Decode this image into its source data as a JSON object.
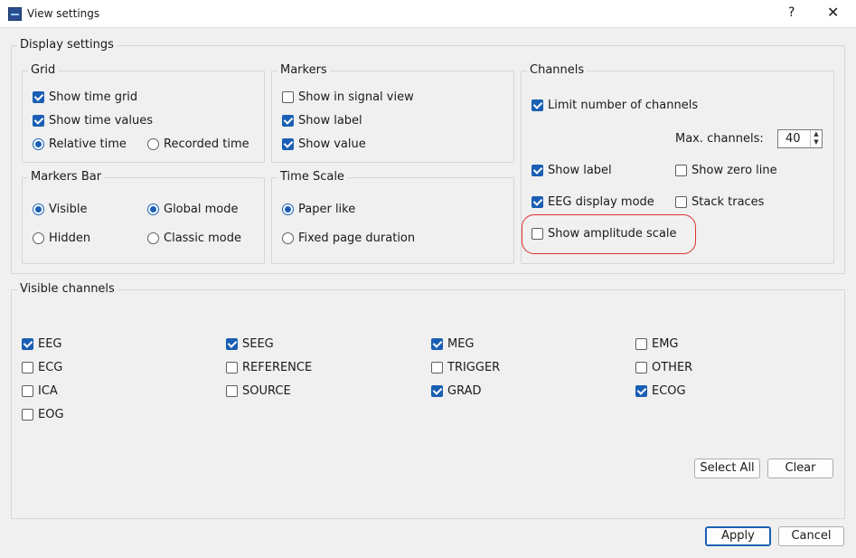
{
  "window": {
    "title": "View settings",
    "help": "?",
    "close": "✕"
  },
  "display": {
    "legend": "Display settings",
    "grid": {
      "legend": "Grid",
      "show_time_grid": {
        "label": "Show time grid",
        "checked": true
      },
      "show_time_values": {
        "label": "Show time values",
        "checked": true
      },
      "relative_time": {
        "label": "Relative time",
        "selected": true
      },
      "recorded_time": {
        "label": "Recorded time",
        "selected": false
      }
    },
    "markers": {
      "legend": "Markers",
      "show_in_signal_view": {
        "label": "Show in signal view",
        "checked": false
      },
      "show_label": {
        "label": "Show label",
        "checked": true
      },
      "show_value": {
        "label": "Show value",
        "checked": true
      }
    },
    "markers_bar": {
      "legend": "Markers Bar",
      "visible": {
        "label": "Visible",
        "selected": true
      },
      "hidden": {
        "label": "Hidden",
        "selected": false
      },
      "global_mode": {
        "label": "Global mode",
        "selected": true
      },
      "classic_mode": {
        "label": "Classic mode",
        "selected": false
      }
    },
    "time_scale": {
      "legend": "Time Scale",
      "paper_like": {
        "label": "Paper like",
        "selected": true
      },
      "fixed_page_duration": {
        "label": "Fixed page duration",
        "selected": false
      }
    },
    "channels": {
      "legend": "Channels",
      "limit_number": {
        "label": "Limit number of channels",
        "checked": true
      },
      "max_channels_label": "Max. channels:",
      "max_channels_value": "40",
      "spin_up": "▲",
      "spin_down": "▼",
      "show_label": {
        "label": "Show label",
        "checked": true
      },
      "show_zero_line": {
        "label": "Show zero line",
        "checked": false
      },
      "eeg_display_mode": {
        "label": "EEG display mode",
        "checked": true
      },
      "stack_traces": {
        "label": "Stack traces",
        "checked": false
      },
      "show_amplitude_scale": {
        "label": "Show amplitude scale",
        "checked": false
      }
    }
  },
  "visible_channels": {
    "legend": "Visible channels",
    "items": [
      {
        "label": "EEG",
        "checked": true
      },
      {
        "label": "SEEG",
        "checked": true
      },
      {
        "label": "MEG",
        "checked": true
      },
      {
        "label": "EMG",
        "checked": false
      },
      {
        "label": "ECG",
        "checked": false
      },
      {
        "label": "REFERENCE",
        "checked": false
      },
      {
        "label": "TRIGGER",
        "checked": false
      },
      {
        "label": "OTHER",
        "checked": false
      },
      {
        "label": "ICA",
        "checked": false
      },
      {
        "label": "SOURCE",
        "checked": false
      },
      {
        "label": "GRAD",
        "checked": true
      },
      {
        "label": "ECOG",
        "checked": true
      },
      {
        "label": "EOG",
        "checked": false
      }
    ],
    "select_all": "Select All",
    "clear": "Clear"
  },
  "footer": {
    "apply": "Apply",
    "cancel": "Cancel"
  },
  "colors": {
    "accent": "#1a5fb4",
    "highlight": "#e03030"
  }
}
